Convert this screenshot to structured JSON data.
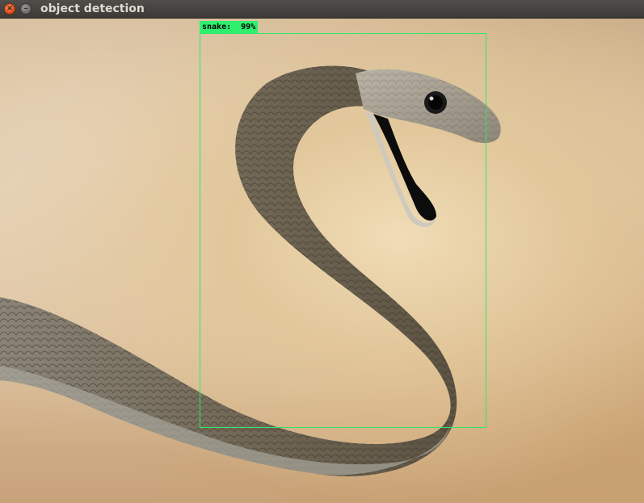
{
  "window": {
    "title": "object detection",
    "buttons": {
      "close_icon": "close-icon",
      "minimize_icon": "minimize-icon"
    }
  },
  "detections": [
    {
      "label": "snake",
      "score_text": "snake:  99%",
      "color": "#2ef06e"
    }
  ],
  "colors": {
    "titlebar": "#3f3e3a",
    "title_text": "#dfdbd2",
    "close_button": "#e4531f",
    "box_stroke": "#2ee86a"
  }
}
